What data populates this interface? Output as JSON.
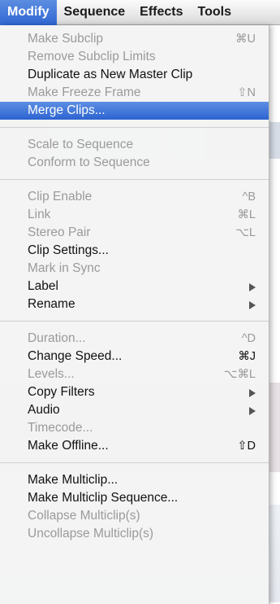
{
  "menubar": {
    "items": [
      {
        "label": "Modify",
        "active": true
      },
      {
        "label": "Sequence"
      },
      {
        "label": "Effects"
      },
      {
        "label": "Tools"
      }
    ]
  },
  "menu": {
    "groups": [
      [
        {
          "label": "Make Subclip",
          "shortcut": "⌘U",
          "enabled": false
        },
        {
          "label": "Remove Subclip Limits",
          "enabled": false
        },
        {
          "label": "Duplicate as New Master Clip",
          "enabled": true
        },
        {
          "label": "Make Freeze Frame",
          "shortcut": "⇧N",
          "enabled": false
        },
        {
          "label": "Merge Clips...",
          "enabled": true,
          "highlighted": true
        }
      ],
      [
        {
          "label": "Scale to Sequence",
          "enabled": false
        },
        {
          "label": "Conform to Sequence",
          "enabled": false
        }
      ],
      [
        {
          "label": "Clip Enable",
          "shortcut": "^B",
          "enabled": false
        },
        {
          "label": "Link",
          "shortcut": "⌘L",
          "enabled": false
        },
        {
          "label": "Stereo Pair",
          "shortcut": "⌥L",
          "enabled": false
        },
        {
          "label": "Clip Settings...",
          "enabled": true
        },
        {
          "label": "Mark in Sync",
          "enabled": false
        },
        {
          "label": "Label",
          "enabled": true,
          "submenu": true
        },
        {
          "label": "Rename",
          "enabled": true,
          "submenu": true
        }
      ],
      [
        {
          "label": "Duration...",
          "shortcut": "^D",
          "enabled": false
        },
        {
          "label": "Change Speed...",
          "shortcut": "⌘J",
          "enabled": true
        },
        {
          "label": "Levels...",
          "shortcut": "⌥⌘L",
          "enabled": false
        },
        {
          "label": "Copy Filters",
          "enabled": true,
          "submenu": true
        },
        {
          "label": "Audio",
          "enabled": true,
          "submenu": true
        },
        {
          "label": "Timecode...",
          "enabled": false
        },
        {
          "label": "Make Offline...",
          "shortcut": "⇧D",
          "enabled": true
        }
      ],
      [
        {
          "label": "Make Multiclip...",
          "enabled": true
        },
        {
          "label": "Make Multiclip Sequence...",
          "enabled": true
        },
        {
          "label": "Collapse Multiclip(s)",
          "enabled": false
        },
        {
          "label": "Uncollapse Multiclip(s)",
          "enabled": false
        }
      ]
    ]
  }
}
